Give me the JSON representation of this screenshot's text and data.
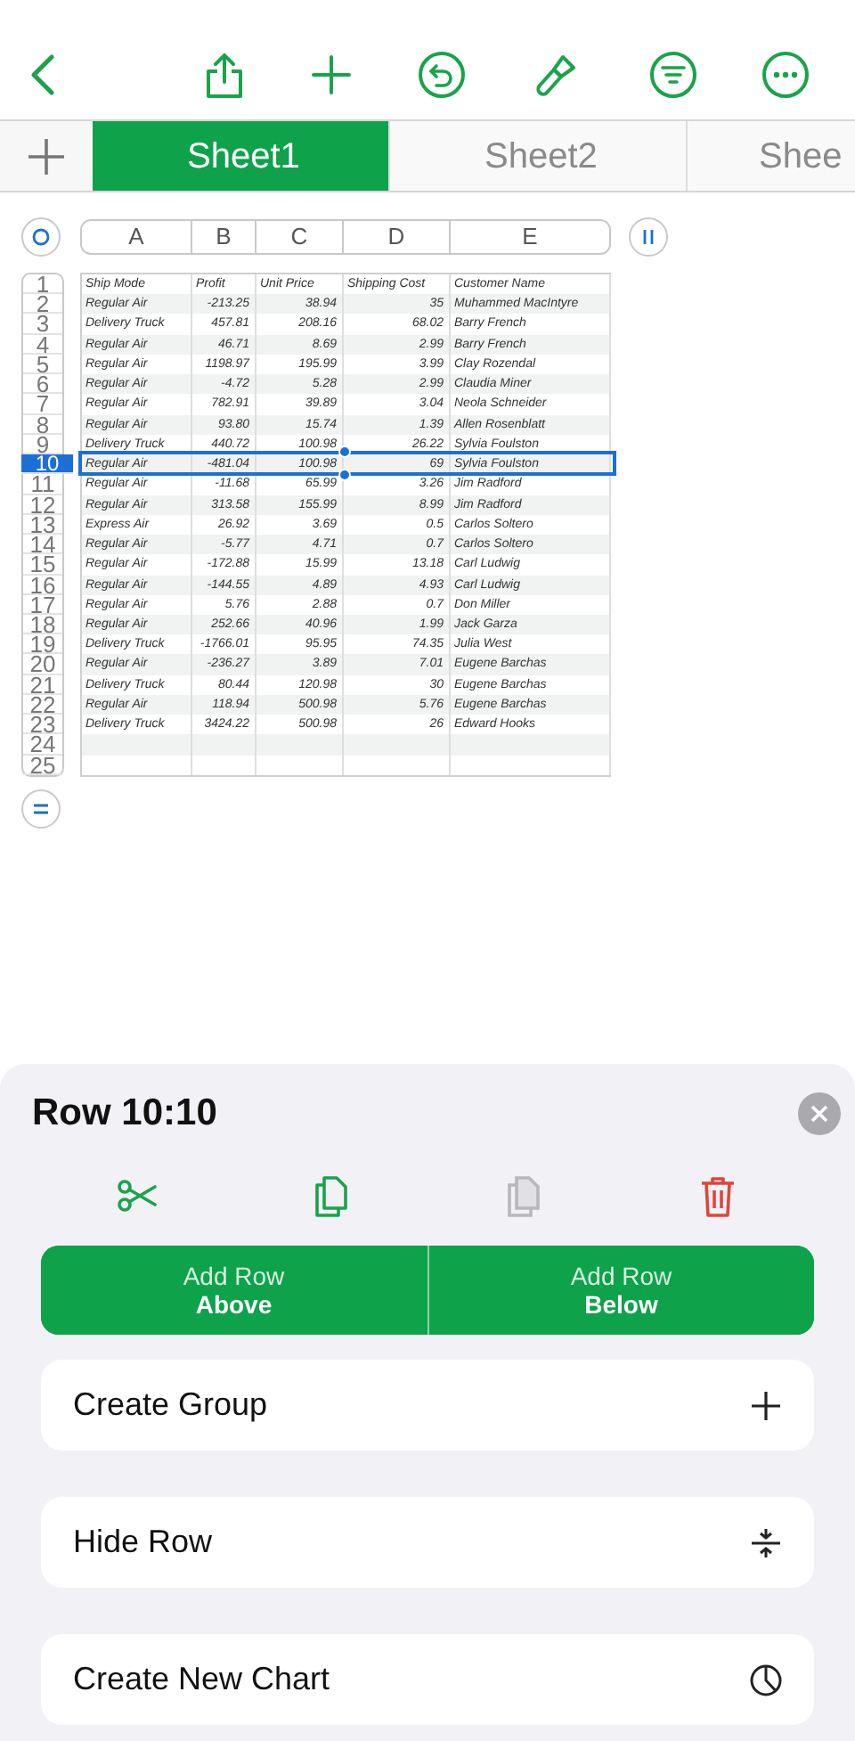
{
  "tabs": [
    {
      "label": "Sheet1",
      "selected": true
    },
    {
      "label": "Sheet2",
      "selected": false
    },
    {
      "label": "Shee",
      "selected": false
    }
  ],
  "sheet": {
    "columns": [
      "A",
      "B",
      "C",
      "D",
      "E"
    ],
    "row_headers": [
      {
        "label": "1",
        "selected": false
      },
      {
        "label": "2",
        "selected": false
      },
      {
        "label": "3",
        "selected": false
      },
      {
        "label": "4",
        "selected": false
      },
      {
        "label": "5",
        "selected": false
      },
      {
        "label": "6",
        "selected": false
      },
      {
        "label": "7",
        "selected": false
      },
      {
        "label": "8",
        "selected": false
      },
      {
        "label": "9",
        "selected": false
      },
      {
        "label": "10",
        "selected": true
      },
      {
        "label": "11",
        "selected": false
      },
      {
        "label": "12",
        "selected": false
      },
      {
        "label": "13",
        "selected": false
      },
      {
        "label": "14",
        "selected": false
      },
      {
        "label": "15",
        "selected": false
      },
      {
        "label": "16",
        "selected": false
      },
      {
        "label": "17",
        "selected": false
      },
      {
        "label": "18",
        "selected": false
      },
      {
        "label": "19",
        "selected": false
      },
      {
        "label": "20",
        "selected": false
      },
      {
        "label": "21",
        "selected": false
      },
      {
        "label": "22",
        "selected": false
      },
      {
        "label": "23",
        "selected": false
      },
      {
        "label": "24",
        "selected": false
      },
      {
        "label": "25",
        "selected": false
      }
    ],
    "rows": [
      [
        "Ship Mode",
        "Profit",
        "Unit Price",
        "Shipping Cost",
        "Customer Name"
      ],
      [
        "Regular Air",
        "-213.25",
        "38.94",
        "35",
        "Muhammed MacIntyre"
      ],
      [
        "Delivery Truck",
        "457.81",
        "208.16",
        "68.02",
        "Barry French"
      ],
      [
        "Regular Air",
        "46.71",
        "8.69",
        "2.99",
        "Barry French"
      ],
      [
        "Regular Air",
        "1198.97",
        "195.99",
        "3.99",
        "Clay Rozendal"
      ],
      [
        "Regular Air",
        "-4.72",
        "5.28",
        "2.99",
        "Claudia Miner"
      ],
      [
        "Regular Air",
        "782.91",
        "39.89",
        "3.04",
        "Neola Schneider"
      ],
      [
        "Regular Air",
        "93.80",
        "15.74",
        "1.39",
        "Allen Rosenblatt"
      ],
      [
        "Delivery Truck",
        "440.72",
        "100.98",
        "26.22",
        "Sylvia Foulston"
      ],
      [
        "Regular Air",
        "-481.04",
        "100.98",
        "69",
        "Sylvia Foulston"
      ],
      [
        "Regular Air",
        "-11.68",
        "65.99",
        "3.26",
        "Jim Radford"
      ],
      [
        "Regular Air",
        "313.58",
        "155.99",
        "8.99",
        "Jim Radford"
      ],
      [
        "Express Air",
        "26.92",
        "3.69",
        "0.5",
        "Carlos Soltero"
      ],
      [
        "Regular Air",
        "-5.77",
        "4.71",
        "0.7",
        "Carlos Soltero"
      ],
      [
        "Regular Air",
        "-172.88",
        "15.99",
        "13.18",
        "Carl Ludwig"
      ],
      [
        "Regular Air",
        "-144.55",
        "4.89",
        "4.93",
        "Carl Ludwig"
      ],
      [
        "Regular Air",
        "5.76",
        "2.88",
        "0.7",
        "Don Miller"
      ],
      [
        "Regular Air",
        "252.66",
        "40.96",
        "1.99",
        "Jack Garza"
      ],
      [
        "Delivery Truck",
        "-1766.01",
        "95.95",
        "74.35",
        "Julia West"
      ],
      [
        "Regular Air",
        "-236.27",
        "3.89",
        "7.01",
        "Eugene Barchas"
      ],
      [
        "Delivery Truck",
        "80.44",
        "120.98",
        "30",
        "Eugene Barchas"
      ],
      [
        "Regular Air",
        "118.94",
        "500.98",
        "5.76",
        "Eugene Barchas"
      ],
      [
        "Delivery Truck",
        "3424.22",
        "500.98",
        "26",
        "Edward Hooks"
      ]
    ]
  },
  "panel": {
    "title": "Row 10:10",
    "actions": [
      {
        "kind": "cut",
        "disabled": false
      },
      {
        "kind": "copy",
        "disabled": false
      },
      {
        "kind": "paste",
        "disabled": true
      },
      {
        "kind": "delete",
        "disabled": false
      }
    ],
    "add_buttons": [
      {
        "line1": "Add Row",
        "line2": "Above"
      },
      {
        "line1": "Add Row",
        "line2": "Below"
      }
    ],
    "menu_items": [
      {
        "label": "Create Group",
        "kind": "group"
      },
      {
        "label": "Hide Row",
        "kind": "hide"
      },
      {
        "label": "Create New Chart",
        "kind": "chart"
      }
    ]
  }
}
